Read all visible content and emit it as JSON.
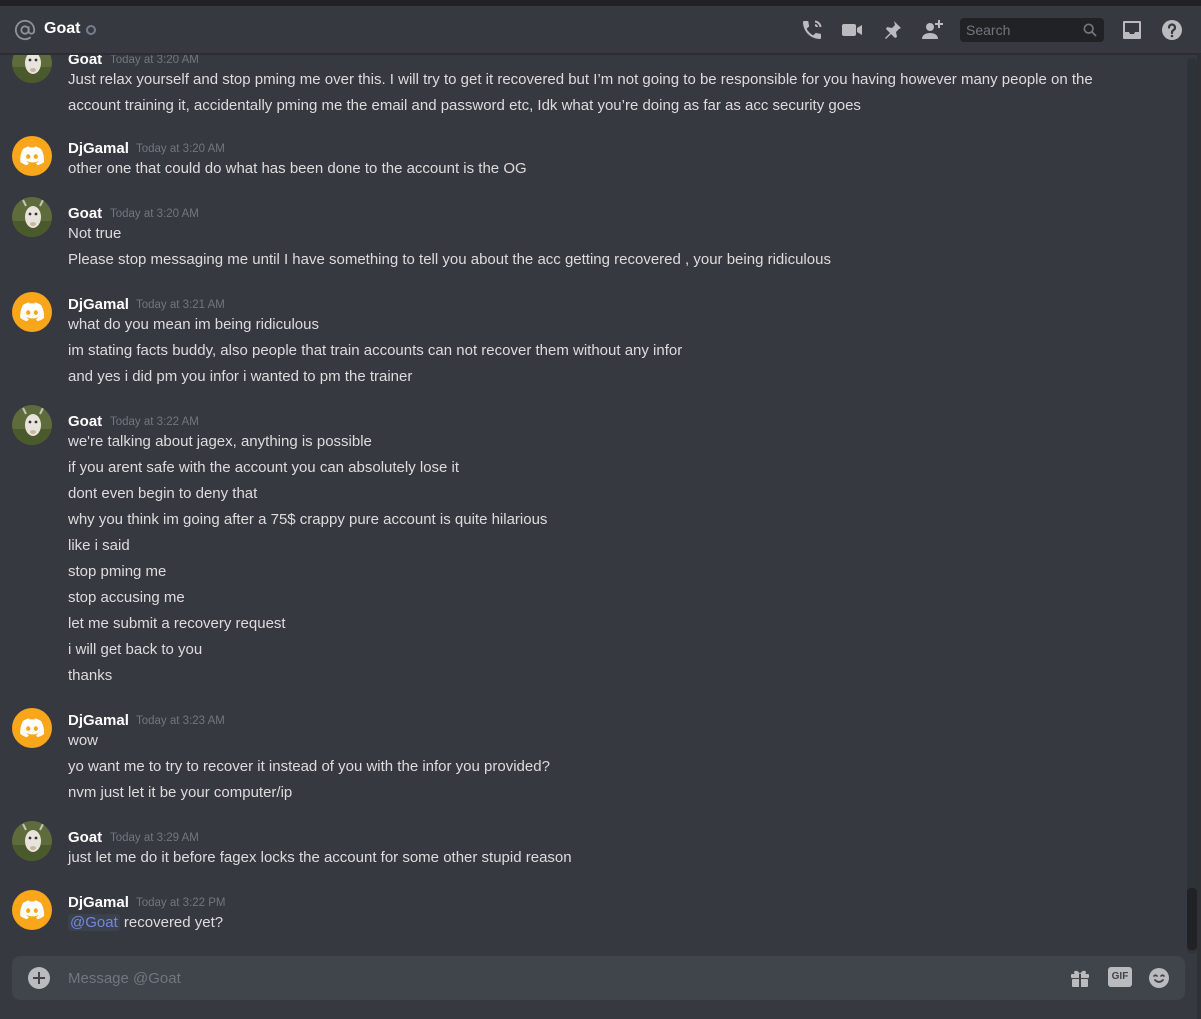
{
  "header": {
    "title": "Goat",
    "search_placeholder": "Search"
  },
  "composer": {
    "placeholder": "Message @Goat",
    "gif_label": "GIF"
  },
  "messages": [
    {
      "author": "Goat",
      "avatar": "goat-photo",
      "timestamp": "Today at 3:20 AM",
      "lines": [
        "Just relax yourself and stop pming me over this. I will try to get it recovered but I’m not going to be responsible for you having however many people on the",
        "account training it, accidentally pming me the email and password etc, Idk what you’re doing as far as acc security goes"
      ]
    },
    {
      "author": "DjGamal",
      "avatar": "discord-logo",
      "timestamp": "Today at 3:20 AM",
      "lines": [
        "other one that could do what has been done to the account is the OG"
      ]
    },
    {
      "author": "Goat",
      "avatar": "goat-photo",
      "timestamp": "Today at 3:20 AM",
      "lines": [
        "Not true",
        "Please stop messaging me until I have something to tell you about the acc getting recovered , your being ridiculous"
      ]
    },
    {
      "author": "DjGamal",
      "avatar": "discord-logo",
      "timestamp": "Today at 3:21 AM",
      "lines": [
        "what do you mean im being ridiculous",
        "im stating facts buddy, also people that train accounts can not recover them without any infor",
        "and yes i did pm you infor i wanted to pm the trainer"
      ]
    },
    {
      "author": "Goat",
      "avatar": "goat-photo",
      "timestamp": "Today at 3:22 AM",
      "lines": [
        "we're talking about jagex, anything is possible",
        "if you arent safe with the account you can absolutely lose it",
        "dont even begin to deny that",
        "why you think im going after a 75$ crappy pure account is quite hilarious",
        "like i said",
        "stop pming me",
        "stop accusing me",
        "let me submit a recovery request",
        "i will get back to you",
        "thanks"
      ]
    },
    {
      "author": "DjGamal",
      "avatar": "discord-logo",
      "timestamp": "Today at 3:23 AM",
      "lines": [
        "wow",
        "yo want me to try to recover it instead of you with the infor you provided?",
        "nvm just let it be your computer/ip"
      ]
    },
    {
      "author": "Goat",
      "avatar": "goat-photo",
      "timestamp": "Today at 3:29 AM",
      "lines": [
        "just let me do it before fagex locks the account for some other stupid reason"
      ]
    },
    {
      "author": "DjGamal",
      "avatar": "discord-logo",
      "timestamp": "Today at 3:22 PM",
      "mention": "@Goat",
      "lines": [
        " recovered yet?"
      ]
    }
  ],
  "icons": {
    "header": [
      "at-icon",
      "start-voice-call-icon",
      "start-video-call-icon",
      "pinned-messages-icon",
      "add-friends-to-dm-icon",
      "search-icon",
      "inbox-icon",
      "help-icon"
    ],
    "composer": [
      "add-attachment-icon",
      "gift-icon",
      "gif-icon",
      "emoji-icon"
    ]
  },
  "colors": {
    "background": "#36393f",
    "header_text": "#ffffff",
    "message_text": "#dcddde",
    "timestamp": "#72767d",
    "mention": "#7289da",
    "discord_avatar": "#faa61a"
  }
}
